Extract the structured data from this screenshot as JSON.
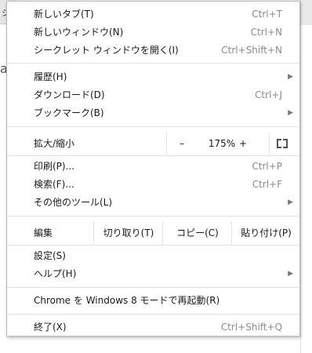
{
  "background": {
    "tab_text": "ジ",
    "page_text": "a"
  },
  "menu": {
    "group1": [
      {
        "label": "新しいタブ(T)",
        "accel": "Ctrl+T"
      },
      {
        "label": "新しいウィンドウ(N)",
        "accel": "Ctrl+N"
      },
      {
        "label": "シークレット ウィンドウを開く(I)",
        "accel": "Ctrl+Shift+N"
      }
    ],
    "group2": [
      {
        "label": "履歴(H)",
        "arrow": "▶"
      },
      {
        "label": "ダウンロード(D)",
        "accel": "Ctrl+J"
      },
      {
        "label": "ブックマーク(B)",
        "arrow": "▶"
      }
    ],
    "zoom": {
      "label": "拡大/縮小",
      "minus": "–",
      "value": "175%",
      "plus": "+"
    },
    "group3": [
      {
        "label": "印刷(P)...",
        "accel": "Ctrl+P"
      },
      {
        "label": "検索(F)...",
        "accel": "Ctrl+F"
      },
      {
        "label": "その他のツール(L)",
        "arrow": "▶"
      }
    ],
    "edit": {
      "label": "編集",
      "cut": "切り取り(T)",
      "copy": "コピー(C)",
      "paste": "貼り付け(P)"
    },
    "group4": [
      {
        "label": "設定(S)"
      },
      {
        "label": "ヘルプ(H)",
        "arrow": "▶"
      }
    ],
    "group5": [
      {
        "label": "Chrome を Windows 8 モードで再起動(R)"
      }
    ],
    "group6": [
      {
        "label": "終了(X)",
        "accel": "Ctrl+Shift+Q"
      }
    ]
  }
}
